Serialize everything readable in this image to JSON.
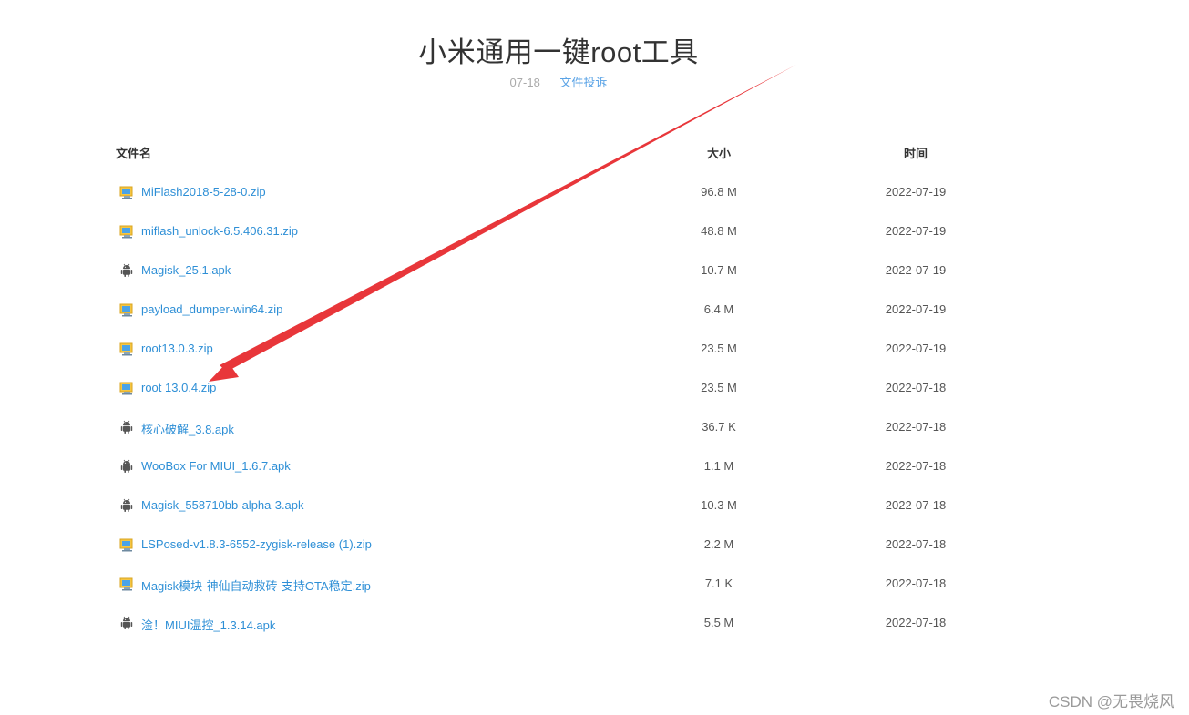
{
  "header": {
    "title": "小米通用一键root工具",
    "date": "07-18",
    "report_link": "文件投诉"
  },
  "table": {
    "columns": {
      "name": "文件名",
      "size": "大小",
      "time": "时间"
    },
    "rows": [
      {
        "icon": "archive-icon",
        "name": "MiFlash2018-5-28-0.zip",
        "size": "96.8 M",
        "time": "2022-07-19"
      },
      {
        "icon": "archive-icon",
        "name": "miflash_unlock-6.5.406.31.zip",
        "size": "48.8 M",
        "time": "2022-07-19"
      },
      {
        "icon": "android-icon",
        "name": "Magisk_25.1.apk",
        "size": "10.7 M",
        "time": "2022-07-19"
      },
      {
        "icon": "archive-icon",
        "name": "payload_dumper-win64.zip",
        "size": "6.4 M",
        "time": "2022-07-19"
      },
      {
        "icon": "archive-icon",
        "name": "root13.0.3.zip",
        "size": "23.5 M",
        "time": "2022-07-19"
      },
      {
        "icon": "archive-icon",
        "name": "root 13.0.4.zip",
        "size": "23.5 M",
        "time": "2022-07-18"
      },
      {
        "icon": "android-icon",
        "name": "核心破解_3.8.apk",
        "size": "36.7 K",
        "time": "2022-07-18"
      },
      {
        "icon": "android-icon",
        "name": "WooBox For MIUI_1.6.7.apk",
        "size": "1.1 M",
        "time": "2022-07-18"
      },
      {
        "icon": "android-icon",
        "name": "Magisk_558710bb-alpha-3.apk",
        "size": "10.3 M",
        "time": "2022-07-18"
      },
      {
        "icon": "archive-icon",
        "name": "LSPosed-v1.8.3-6552-zygisk-release (1).zip",
        "size": "2.2 M",
        "time": "2022-07-18"
      },
      {
        "icon": "archive-icon",
        "name": "Magisk模块-神仙自动救砖-支持OTA稳定.zip",
        "size": "7.1 K",
        "time": "2022-07-18"
      },
      {
        "icon": "android-icon",
        "name": "淦！MIUI温控_1.3.14.apk",
        "size": "5.5 M",
        "time": "2022-07-18"
      }
    ]
  },
  "annotation": {
    "arrow_color": "#e8363a"
  },
  "watermark": "CSDN @无畏烧风",
  "colors": {
    "link": "#2e8fd6",
    "text": "#555555",
    "title": "#333333"
  }
}
